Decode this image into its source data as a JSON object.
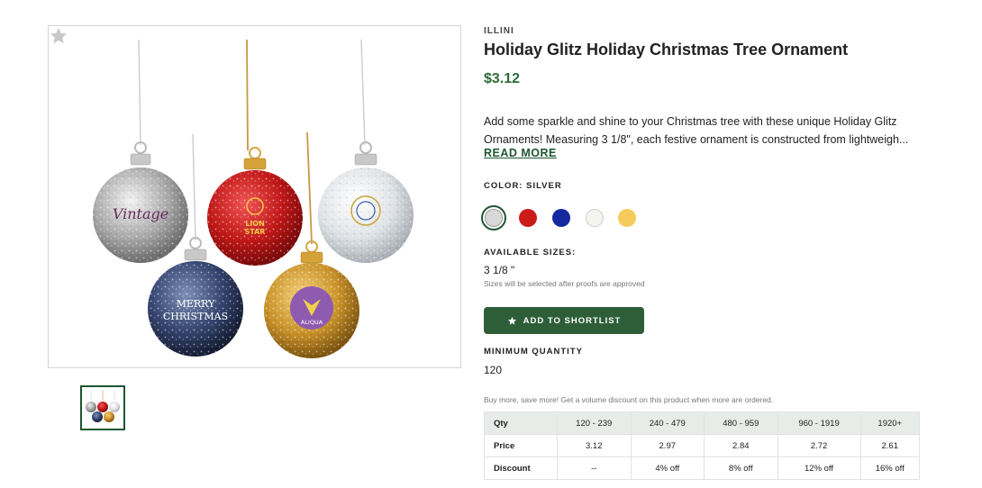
{
  "product": {
    "brand": "ILLINI",
    "title": "Holiday Glitz Holiday Christmas Tree Ornament",
    "price": "$3.12",
    "description_line1": "Add some sparkle and shine to your Christmas tree with these unique Holiday Glitz",
    "description_line2": "Ornaments! Measuring 3 1/8\", each festive ornament is constructed from lightweigh...",
    "read_more": "READ MORE"
  },
  "gallery": {
    "favorite_icon": "star-icon",
    "ornament_texts": {
      "silver": "Vintage",
      "red_1": "LION",
      "red_2": "STAR",
      "blue_1": "MERRY",
      "blue_2": "CHRISTMAS",
      "gold": "ALIQUA"
    }
  },
  "color": {
    "label": "COLOR: SILVER",
    "swatches": [
      {
        "name": "silver",
        "hex": "#d9d9d9"
      },
      {
        "name": "red",
        "hex": "#cc1b1b"
      },
      {
        "name": "blue",
        "hex": "#1428a0"
      },
      {
        "name": "white",
        "hex": "#f5f3ee"
      },
      {
        "name": "gold",
        "hex": "#f5cc5a"
      }
    ]
  },
  "sizes": {
    "label": "AVAILABLE SIZES:",
    "value": "3 1/8 \"",
    "note": "Sizes will be selected after proofs are approved"
  },
  "shortlist": {
    "label": "ADD TO SHORTLIST",
    "icon": "star-icon"
  },
  "minimum_quantity": {
    "label": "MINIMUM QUANTITY",
    "value": "120"
  },
  "pricing": {
    "note": "Buy more, save more! Get a volume discount on this product when more are ordered.",
    "header": [
      "Qty",
      "120 - 239",
      "240 - 479",
      "480 - 959",
      "960 - 1919",
      "1920+"
    ],
    "price_row": [
      "Price",
      "3.12",
      "2.97",
      "2.84",
      "2.72",
      "2.61"
    ],
    "discount_row": [
      "Discount",
      "--",
      "4% off",
      "8% off",
      "12% off",
      "16% off"
    ]
  },
  "colors": {
    "accent_green": "#2e6b3a",
    "button_green": "#2e5e38"
  }
}
